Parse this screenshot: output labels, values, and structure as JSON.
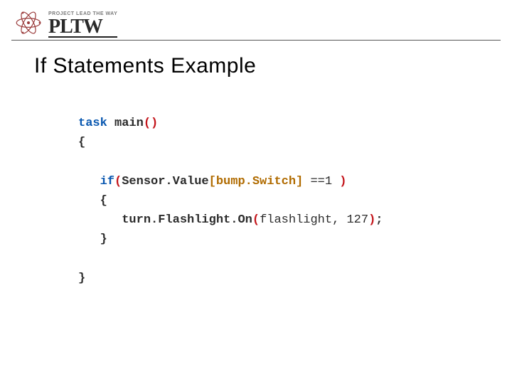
{
  "header": {
    "tagline": "PROJECT LEAD THE WAY",
    "brand": "PLTW"
  },
  "title": "If Statements Example",
  "code": {
    "l1_kw": "task",
    "l1_fn": " main",
    "l1_par": "()",
    "l2_br": "{",
    "l4_kw": "if",
    "l4_par1": "(",
    "l4_obj": "Sensor.Value",
    "l4_idx": "[bump.Switch]",
    "l4_expr": " ==1 ",
    "l4_par2": ")",
    "l5_br": "{",
    "l6_fn": "turn.Flashlight.On",
    "l6_par1": "(",
    "l6_args": "flashlight, 127",
    "l6_par2": ")",
    "l6_sc": ";",
    "l7_br": "}",
    "l9_br": "}"
  }
}
